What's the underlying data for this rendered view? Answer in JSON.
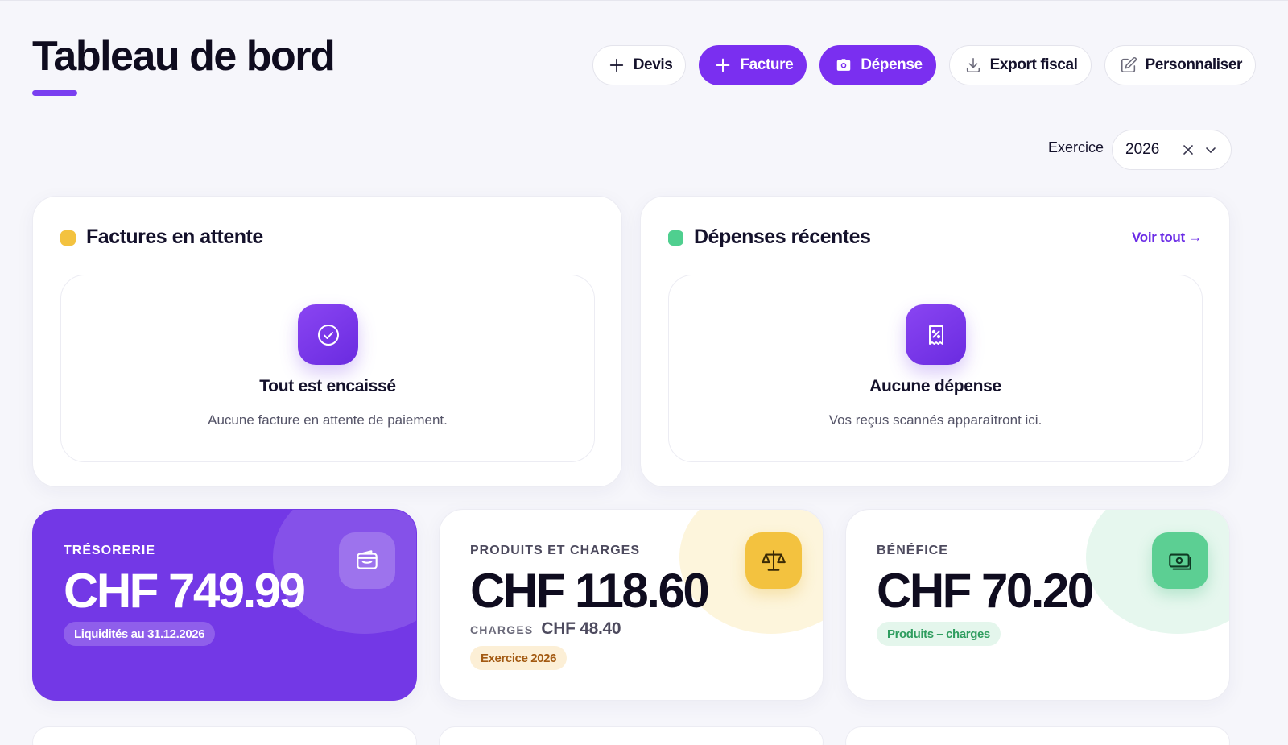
{
  "header": {
    "title": "Tableau de bord",
    "actions": [
      {
        "label": "Devis",
        "icon": "plus-icon"
      },
      {
        "label": "Facture",
        "icon": "plus-icon"
      },
      {
        "label": "Dépense",
        "icon": "camera-icon"
      },
      {
        "label": "Export fiscal",
        "icon": "download-icon"
      },
      {
        "label": "Personnaliser",
        "icon": "edit-icon"
      }
    ]
  },
  "exercise": {
    "label": "Exercice",
    "value": "2026"
  },
  "pending_invoices": {
    "title": "Factures en attente",
    "dot_color": "#f3c23f",
    "empty_title": "Tout est encaissé",
    "empty_text": "Aucune facture en attente de paiement."
  },
  "recent_expenses": {
    "title": "Dépenses récentes",
    "dot_color": "#4fcf8f",
    "view_all": "Voir tout →",
    "empty_title": "Aucune dépense",
    "empty_text": "Vos reçus scannés apparaîtront ici."
  },
  "kpis": {
    "treasury": {
      "label": "TRÉSORERIE",
      "value": "CHF 749.99",
      "badge": "Liquidités au 31.12.2026"
    },
    "income_expenses": {
      "label": "PRODUITS ET CHARGES",
      "value": "CHF 118.60",
      "charges_label": "CHARGES",
      "charges_value": "CHF 48.40",
      "badge": "Exercice 2026"
    },
    "profit": {
      "label": "BÉNÉFICE",
      "value": "CHF 70.20",
      "badge": "Produits – charges"
    }
  },
  "colors": {
    "accent": "#7a2ff0",
    "page_bg": "#f6f6fb"
  }
}
